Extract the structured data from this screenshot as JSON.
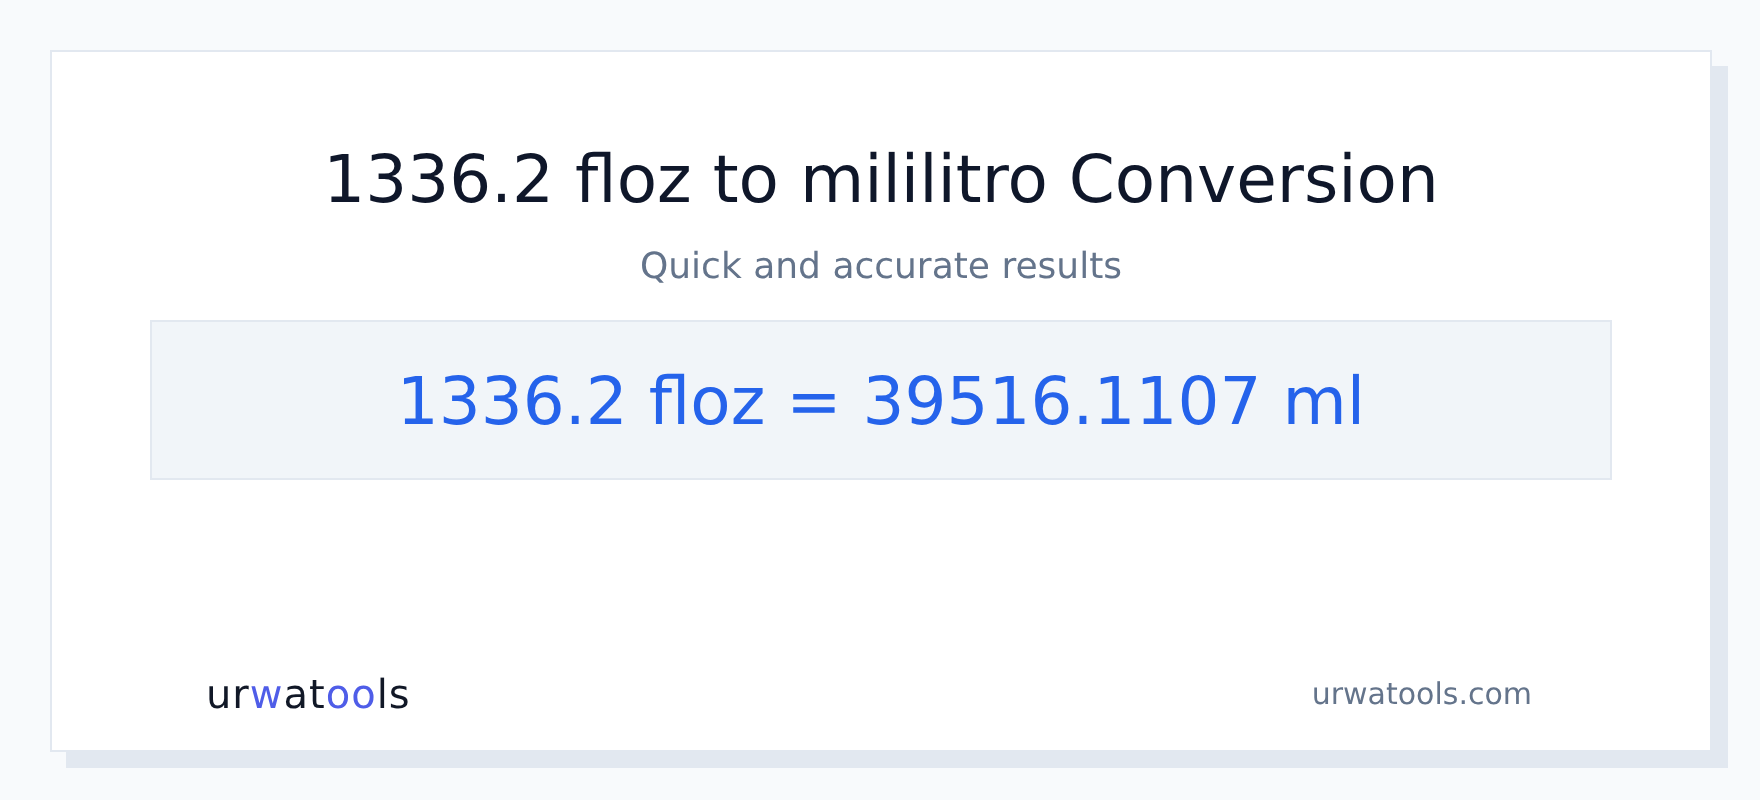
{
  "title": "1336.2 floz to mililitro Conversion",
  "subtitle": "Quick and accurate results",
  "result": "1336.2 floz = 39516.1107 ml",
  "logo": [
    {
      "text": "ur",
      "accent": false
    },
    {
      "text": "w",
      "accent": true
    },
    {
      "text": "at",
      "accent": false
    },
    {
      "text": "oo",
      "accent": true
    },
    {
      "text": "ls",
      "accent": false
    }
  ],
  "site": "urwatools.com"
}
